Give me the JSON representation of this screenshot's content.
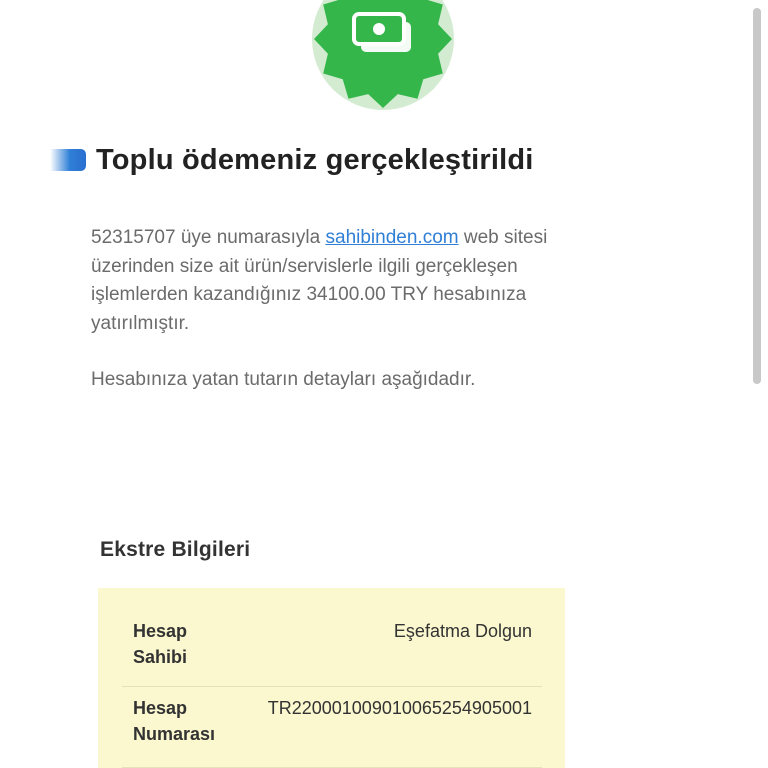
{
  "colors": {
    "badge_green": "#34b64a",
    "badge_light_green": "#d3ecd1",
    "accent_blue": "#2f7fd6",
    "statement_background": "#fbf8cf",
    "body_text": "#6b6b6b",
    "heading_text": "#222222"
  },
  "header": {
    "badge_icon": "money-banknote-icon",
    "title_accent_icon": "blue-bar-accent",
    "title": "Toplu ödemeniz gerçekleştirildi"
  },
  "intro": {
    "text_1": "52315707 üye numarasıyla ",
    "link": "sahibinden.com",
    "text_2": " web sitesi üzerinden size ait ürün/servislerle ilgili gerçekleşen işlemlerden kazandığınız 34100.00 TRY hesabınıza yatırılmıştır."
  },
  "detail_line": "Hesabınıza yatan tutarın detayları aşağıdadır.",
  "statement": {
    "title": "Ekstre Bilgileri",
    "rows": [
      {
        "label": "Hesap Sahibi",
        "value": "Eşefatma Dolgun"
      },
      {
        "label": "Hesap Numarası",
        "value": "TR220001009010065254905001"
      }
    ]
  }
}
